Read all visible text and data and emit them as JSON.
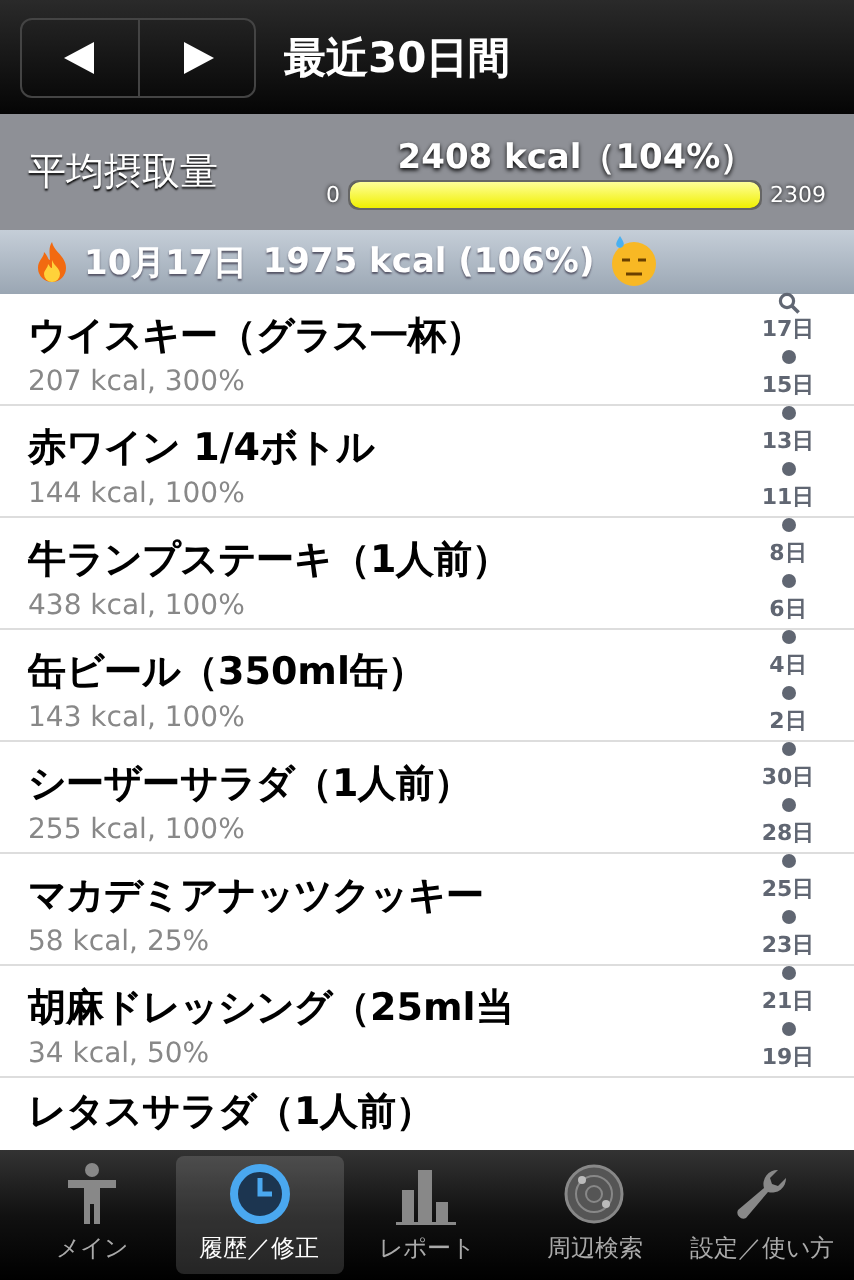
{
  "nav": {
    "title": "最近30日間"
  },
  "summary": {
    "label": "平均摂取量",
    "value": "2408 kcal（104%）",
    "min": "0",
    "max": "2309",
    "level": 1
  },
  "section": {
    "date": "10月17日",
    "total": "1975 kcal (106%)"
  },
  "items": [
    {
      "title": "ウイスキー（グラス一杯）",
      "detail": "207 kcal, 300%"
    },
    {
      "title": "赤ワイン 1/4ボトル",
      "detail": "144 kcal, 100%"
    },
    {
      "title": "牛ランプステーキ（1人前）",
      "detail": "438 kcal, 100%"
    },
    {
      "title": "缶ビール（350ml缶）",
      "detail": "143 kcal, 100%"
    },
    {
      "title": "シーザーサラダ（1人前）",
      "detail": "255 kcal, 100%"
    },
    {
      "title": "マカデミアナッツクッキー",
      "detail": "58 kcal, 25%"
    },
    {
      "title": "胡麻ドレッシング（25ml当",
      "detail": "34 kcal, 50%"
    },
    {
      "title": "レタスサラダ（1人前）"
    }
  ],
  "index": [
    "17日",
    "15日",
    "13日",
    "11日",
    "8日",
    "6日",
    "4日",
    "2日",
    "30日",
    "28日",
    "25日",
    "23日",
    "21日",
    "19日"
  ],
  "tabs": [
    {
      "label": "メイン",
      "selected": false
    },
    {
      "label": "履歴／修正",
      "selected": true
    },
    {
      "label": "レポート",
      "selected": false
    },
    {
      "label": "周辺検索",
      "selected": false
    },
    {
      "label": "設定／使い方",
      "selected": false
    }
  ]
}
